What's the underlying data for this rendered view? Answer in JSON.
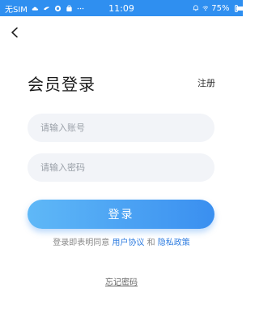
{
  "status_bar": {
    "carrier": "无SIM",
    "time": "11:09",
    "battery": "75%",
    "battery_level": 0.75,
    "background_color": "#2f8ff0"
  },
  "header": {
    "back_icon": "chevron-left-icon"
  },
  "login": {
    "title": "会员登录",
    "register_label": "注册",
    "account_placeholder": "请输入账号",
    "password_placeholder": "请输入密码",
    "submit_label": "登录",
    "accent_color": "#3a8ff0"
  },
  "agreement": {
    "prefix": "登录即表明同意",
    "user_agreement": "用户协议",
    "and": "和",
    "privacy_policy": "隐私政策"
  },
  "forgot_password_label": "忘记密码"
}
